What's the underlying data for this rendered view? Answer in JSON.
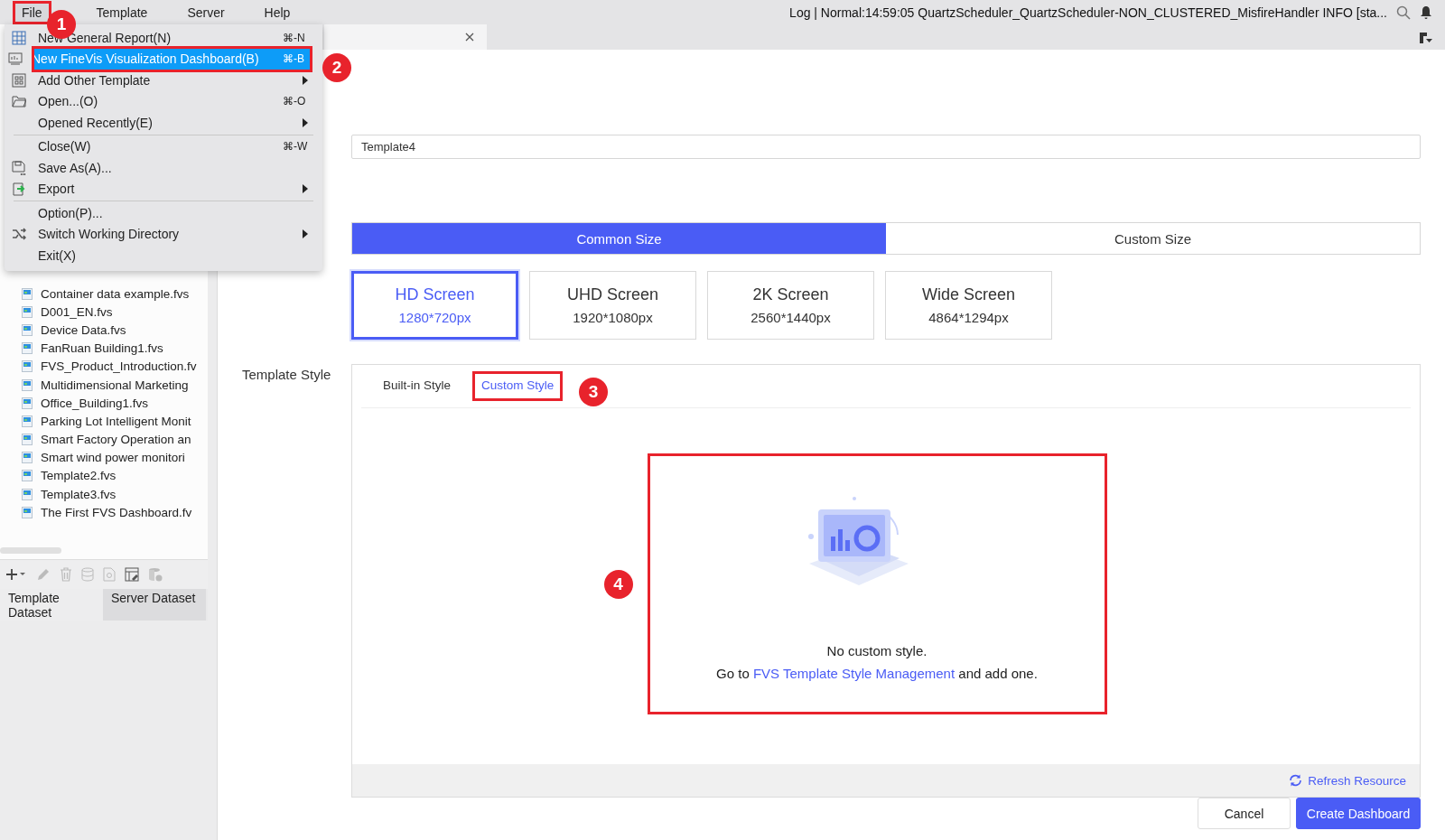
{
  "menu_bar": {
    "menus": [
      {
        "label": "File",
        "open": true,
        "callout": "1"
      },
      {
        "label": "Template",
        "open": false
      },
      {
        "label": "Server",
        "open": false
      },
      {
        "label": "Help",
        "open": false
      }
    ],
    "log": "Log | Normal:14:59:05 QuartzScheduler_QuartzScheduler-NON_CLUSTERED_MisfireHandler INFO [sta..."
  },
  "file_menu": {
    "items": [
      {
        "kind": "item",
        "label": "New General Report(N)",
        "shortcut": "⌘-N",
        "submenu": false,
        "selected": false
      },
      {
        "kind": "item",
        "label": "New FineVis Visualization Dashboard(B)",
        "shortcut": "⌘-B",
        "submenu": false,
        "selected": true,
        "callout": "2"
      },
      {
        "kind": "item",
        "label": "Add Other Template",
        "submenu": true,
        "selected": false
      },
      {
        "kind": "item",
        "label": "Open...(O)",
        "shortcut": "⌘-O",
        "submenu": false,
        "selected": false
      },
      {
        "kind": "item",
        "label": "Opened Recently(E)",
        "submenu": true,
        "selected": false
      },
      {
        "kind": "separator"
      },
      {
        "kind": "item",
        "label": "Close(W)",
        "shortcut": "⌘-W",
        "submenu": false,
        "selected": false
      },
      {
        "kind": "item",
        "label": "Save As(A)...",
        "submenu": false,
        "selected": false
      },
      {
        "kind": "item",
        "label": "Export",
        "submenu": true,
        "selected": false
      },
      {
        "kind": "separator"
      },
      {
        "kind": "item",
        "label": "Option(P)...",
        "submenu": false,
        "selected": false
      },
      {
        "kind": "item",
        "label": "Switch Working Directory",
        "submenu": true,
        "selected": false
      },
      {
        "kind": "item",
        "label": "Exit(X)",
        "submenu": false,
        "selected": false
      }
    ]
  },
  "file_tree": {
    "items": [
      "Container data example.fvs",
      "D001_EN.fvs",
      "Device Data.fvs",
      "FanRuan Building1.fvs",
      "FVS_Product_Introduction.fv",
      "Multidimensional Marketing",
      "Office_Building1.fvs",
      "Parking Lot Intelligent Monit",
      "Smart Factory Operation an",
      "Smart wind power monitori",
      "Template2.fvs",
      "Template3.fvs",
      "The First FVS Dashboard.fv"
    ]
  },
  "dataset_tabs": [
    {
      "label": "Template Dataset",
      "selected": true
    },
    {
      "label": "Server Dataset",
      "selected": false
    }
  ],
  "dialog": {
    "name_field": {
      "value": "Template4"
    },
    "size_modes": [
      {
        "label": "Common Size",
        "selected": true
      },
      {
        "label": "Custom Size",
        "selected": false
      }
    ],
    "screens": [
      {
        "name": "HD Screen",
        "resolution": "1280*720px",
        "selected": true
      },
      {
        "name": "UHD Screen",
        "resolution": "1920*1080px",
        "selected": false
      },
      {
        "name": "2K Screen",
        "resolution": "2560*1440px",
        "selected": false
      },
      {
        "name": "Wide Screen",
        "resolution": "4864*1294px",
        "selected": false
      }
    ],
    "template_style": {
      "label": "Template Style",
      "tabs": [
        {
          "label": "Built-in Style",
          "selected": false
        },
        {
          "label": "Custom Style",
          "selected": true,
          "callout": "3"
        }
      ],
      "empty_state": {
        "title": "No custom style.",
        "hint_before": "Go to ",
        "link": "FVS Template Style Management",
        "hint_after": " and add one.",
        "callout": "4"
      },
      "refresh": "Refresh Resource"
    },
    "buttons": [
      {
        "label": "Cancel",
        "kind": "secondary"
      },
      {
        "label": "Create Dashboard",
        "kind": "primary"
      }
    ]
  }
}
